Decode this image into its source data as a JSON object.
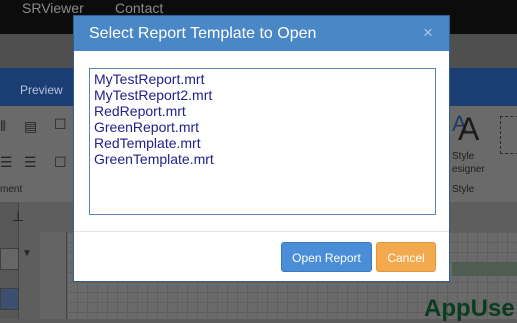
{
  "topnav": {
    "srviewer": "SRViewer",
    "contact": "Contact"
  },
  "ribbon": {
    "preview_tab": "Preview",
    "style_label": "Style",
    "designer_label": "esigner",
    "style_group": "Style",
    "left_group": "ment"
  },
  "canvas": {
    "text": "AppUse"
  },
  "dialog": {
    "title": "Select Report Template to Open",
    "close_glyph": "×",
    "templates": [
      "MyTestReport.mrt",
      "MyTestReport2.mrt",
      "RedReport.mrt",
      "GreenReport.mrt",
      "RedTemplate.mrt",
      "GreenTemplate.mrt"
    ],
    "open_button": "Open Report",
    "cancel_button": "Cancel"
  },
  "colors": {
    "header": "#4a87c6",
    "open_button": "#4a8ed8",
    "cancel_button": "#f3a94e",
    "list_text": "#1f1f8a"
  }
}
